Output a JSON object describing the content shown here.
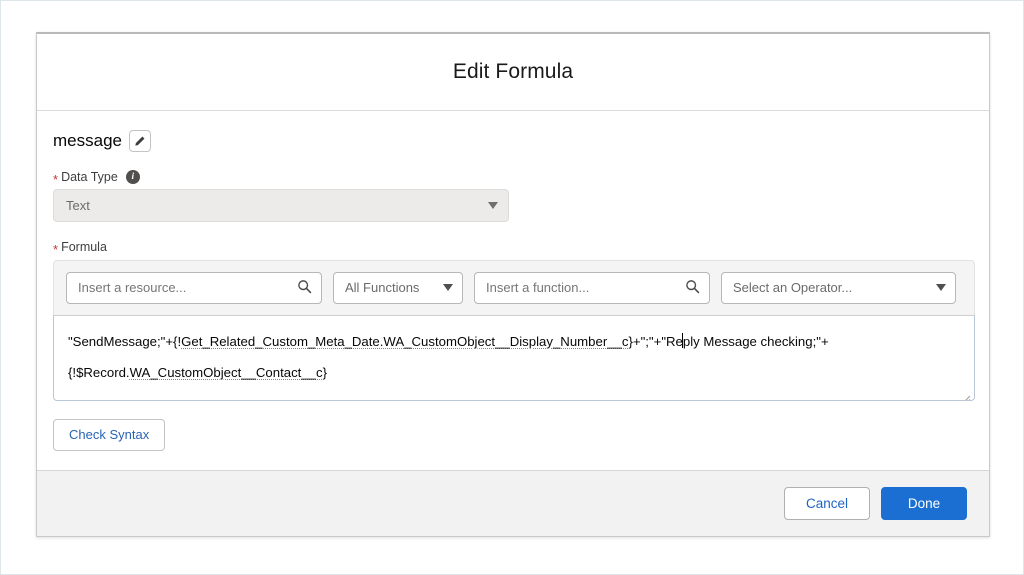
{
  "modal": {
    "title": "Edit Formula"
  },
  "resource": {
    "name": "message",
    "edit_icon": "pencil-icon"
  },
  "data_type": {
    "label": "Data Type",
    "required_marker": "*",
    "info_icon": "info-icon",
    "value": "Text",
    "caret_icon": "chevron-down-icon"
  },
  "formula": {
    "label": "Formula",
    "required_marker": "*",
    "toolbar": {
      "resource_placeholder": "Insert a resource...",
      "resource_value": "",
      "resource_search_icon": "search-icon",
      "functions_filter": "All Functions",
      "functions_filter_caret": "chevron-down-icon",
      "function_placeholder": "Insert a function...",
      "function_value": "",
      "function_search_icon": "search-icon",
      "operator": "Select an Operator...",
      "operator_caret": "chevron-down-icon"
    },
    "text_line1_a": "\"SendMessage;\"+{!",
    "text_line1_b": "Get_Related_Custom_Meta_Date.WA_CustomObject__Display_Number__c",
    "text_line1_c": "}+\";\"+\"Re",
    "text_line1_d": "ply Message checking;\"+",
    "text_line2_a": "{!$Record.",
    "text_line2_b": "WA_CustomObject__Contact__c",
    "text_line2_c": "}",
    "full_text": "\"SendMessage;\"+{!Get_Related_Custom_Meta_Date.WA_CustomObject__Display_Number__c}+\";\"+\"Reply Message checking;\"+{!$Record.WA_CustomObject__Contact__c}",
    "resize_handle": "resize-grip"
  },
  "actions": {
    "check_syntax": "Check Syntax",
    "cancel": "Cancel",
    "done": "Done"
  },
  "colors": {
    "primary_blue": "#1b6fd3",
    "link_blue": "#2b64b4",
    "required_red": "#c23934",
    "spellcheck_red": "#e85b5b",
    "footer_gray": "#f3f2f2",
    "toolbar_gray": "#f4f4f4",
    "disabled_gray": "#ecebea"
  }
}
